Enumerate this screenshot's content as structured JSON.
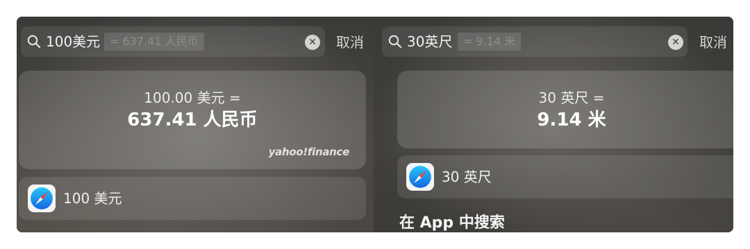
{
  "left": {
    "search": {
      "query": "100美元",
      "suggestion": "= 637.41 人民币"
    },
    "cancel_label": "取消",
    "conversion": {
      "from": "100.00 美元 =",
      "to": "637.41 人民币",
      "source_logo": "yahoo!finance"
    },
    "suggestion_row": {
      "icon": "safari-icon",
      "label": "100 美元"
    }
  },
  "right": {
    "search": {
      "query": "30英尺",
      "suggestion": "= 9.14 米"
    },
    "cancel_label": "取消",
    "conversion": {
      "from": "30 英尺 =",
      "to": "9.14 米"
    },
    "suggestion_row": {
      "icon": "safari-icon",
      "label": "30 英尺"
    },
    "section_title": "在 App 中搜索"
  },
  "icons": {
    "search": "search-icon",
    "clear": "close-icon",
    "app": "safari-icon"
  }
}
